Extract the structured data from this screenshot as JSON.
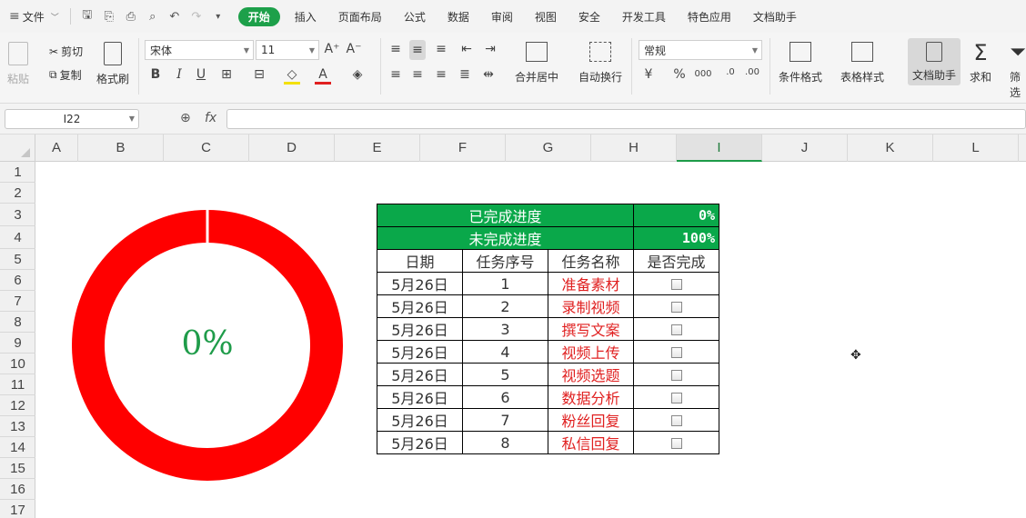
{
  "menubar": {
    "file_label": "文件",
    "tabs": [
      "开始",
      "插入",
      "页面布局",
      "公式",
      "数据",
      "审阅",
      "视图",
      "安全",
      "开发工具",
      "特色应用",
      "文档助手"
    ],
    "active_tab": "开始"
  },
  "ribbon": {
    "paste": "粘贴",
    "cut": "剪切",
    "copy": "复制",
    "format_painter": "格式刷",
    "font_name": "宋体",
    "font_size": "11",
    "merge_center": "合并居中",
    "wrap_text": "自动换行",
    "number_format": "常规",
    "conditional_format": "条件格式",
    "table_style": "表格样式",
    "doc_assistant": "文档助手",
    "sum": "求和",
    "filter": "筛选",
    "percent": "%",
    "thousands": "000"
  },
  "formula_bar": {
    "name_box": "I22",
    "fx": "fx",
    "value": ""
  },
  "columns": [
    "A",
    "B",
    "C",
    "D",
    "E",
    "F",
    "G",
    "H",
    "I",
    "J",
    "K",
    "L"
  ],
  "active_column": "I",
  "rows": [
    "1",
    "2",
    "3",
    "4",
    "5",
    "6",
    "7",
    "8",
    "9",
    "10",
    "11",
    "12",
    "13",
    "14",
    "15",
    "16",
    "17"
  ],
  "donut": {
    "label": "0%",
    "completed_fraction": 0,
    "ring_color": "#ff0000",
    "label_color": "#1f9c4a"
  },
  "summary": {
    "completed_label": "已完成进度",
    "completed_value": "0%",
    "remaining_label": "未完成进度",
    "remaining_value": "100%"
  },
  "table": {
    "headers": [
      "日期",
      "任务序号",
      "任务名称",
      "是否完成"
    ],
    "rows": [
      {
        "date": "5月26日",
        "num": "1",
        "name": "准备素材",
        "done": false
      },
      {
        "date": "5月26日",
        "num": "2",
        "name": "录制视频",
        "done": false
      },
      {
        "date": "5月26日",
        "num": "3",
        "name": "撰写文案",
        "done": false
      },
      {
        "date": "5月26日",
        "num": "4",
        "name": "视频上传",
        "done": false
      },
      {
        "date": "5月26日",
        "num": "5",
        "name": "视频选题",
        "done": false
      },
      {
        "date": "5月26日",
        "num": "6",
        "name": "数据分析",
        "done": false
      },
      {
        "date": "5月26日",
        "num": "7",
        "name": "粉丝回复",
        "done": false
      },
      {
        "date": "5月26日",
        "num": "8",
        "name": "私信回复",
        "done": false
      }
    ]
  }
}
